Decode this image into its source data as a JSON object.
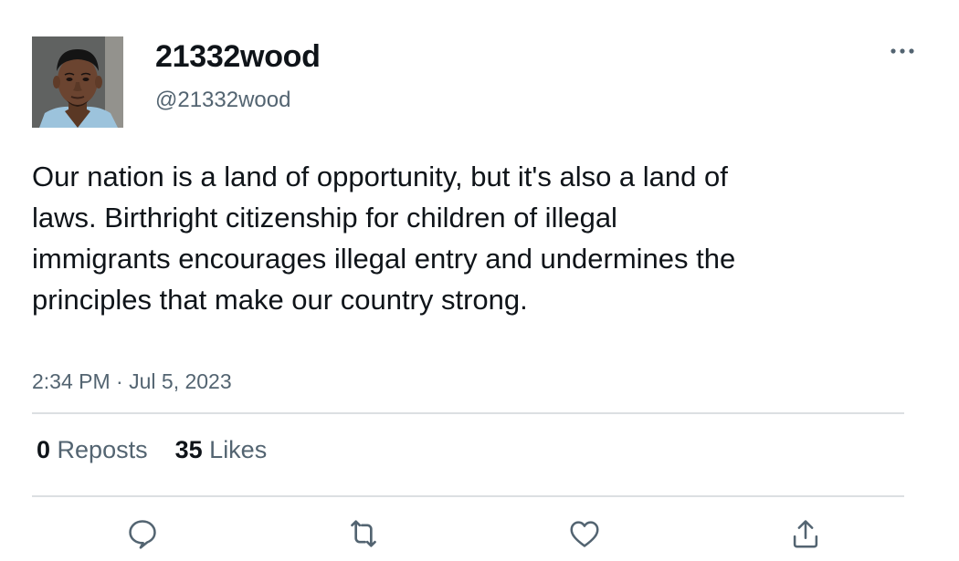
{
  "author": {
    "display_name": "21332wood",
    "handle": "@21332wood",
    "avatar_icon": "profile-photo"
  },
  "post": {
    "text": "Our nation is a land of opportunity, but it's also a land of laws. Birthright citizenship for children of illegal immigrants encourages illegal entry and undermines the principles that make our country strong.",
    "time": "2:34 PM",
    "separator": "·",
    "date": "Jul 5, 2023"
  },
  "stats": {
    "reposts_count": "0",
    "reposts_label": "Reposts",
    "likes_count": "35",
    "likes_label": "Likes"
  },
  "actions": {
    "icons": [
      "reply-icon",
      "repost-icon",
      "like-icon",
      "share-icon"
    ]
  },
  "colors": {
    "text_primary": "#0f1419",
    "text_secondary": "#536471",
    "divider": "#dcdfe2",
    "icon": "#536471"
  }
}
